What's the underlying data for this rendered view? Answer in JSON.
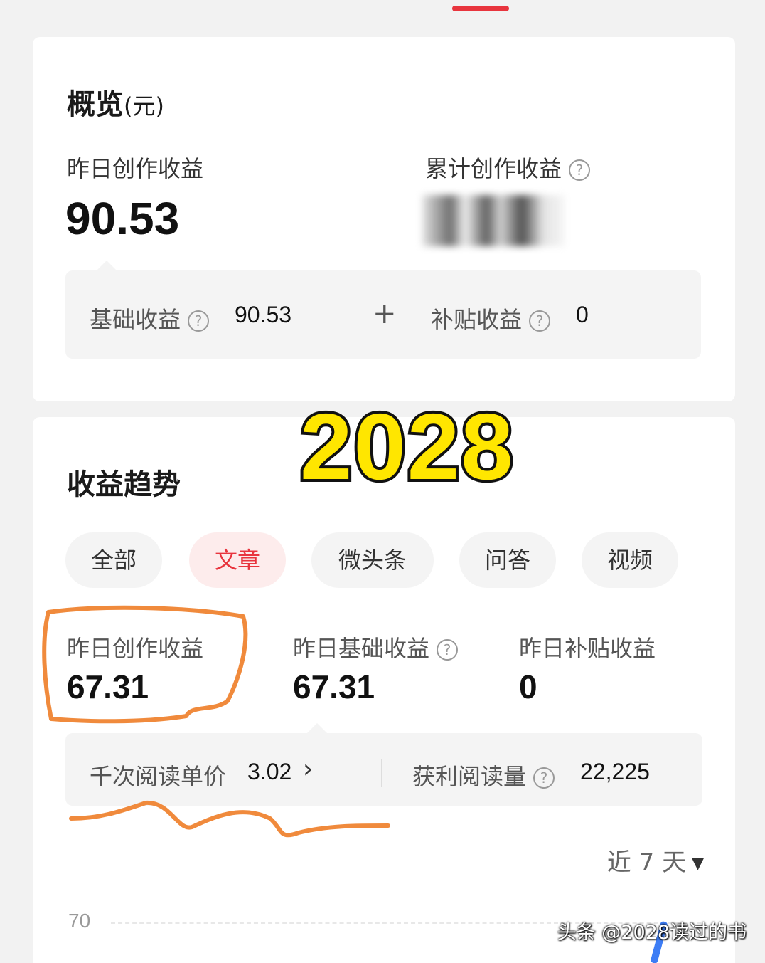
{
  "overview": {
    "title": "概览",
    "unit": "(元)",
    "yesterday_label": "昨日创作收益",
    "yesterday_value": "90.53",
    "total_label": "累计创作收益",
    "breakdown": {
      "base_label": "基础收益",
      "base_value": "90.53",
      "plus": "+",
      "subsidy_label": "补贴收益",
      "subsidy_value": "0"
    }
  },
  "watermark_text": "2028",
  "trend": {
    "title": "收益趋势",
    "tabs": [
      {
        "label": "全部",
        "active": false
      },
      {
        "label": "文章",
        "active": true
      },
      {
        "label": "微头条",
        "active": false
      },
      {
        "label": "问答",
        "active": false
      },
      {
        "label": "视频",
        "active": false
      }
    ],
    "stats": [
      {
        "label": "昨日创作收益",
        "value": "67.31"
      },
      {
        "label": "昨日基础收益",
        "value": "67.31"
      },
      {
        "label": "昨日补贴收益",
        "value": "0"
      }
    ],
    "detail": {
      "rpm_label": "千次阅读单价",
      "rpm_value": "3.02",
      "reads_label": "获利阅读量",
      "reads_value": "22,225"
    },
    "range_label": "近 7 天",
    "axis_top": "70"
  },
  "attribution": "头条 @2028读过的书",
  "colors": {
    "accent": "#e8353e",
    "annotation": "#f08a3c",
    "watermark": "#ffe600",
    "chart_line": "#3d7df5"
  }
}
